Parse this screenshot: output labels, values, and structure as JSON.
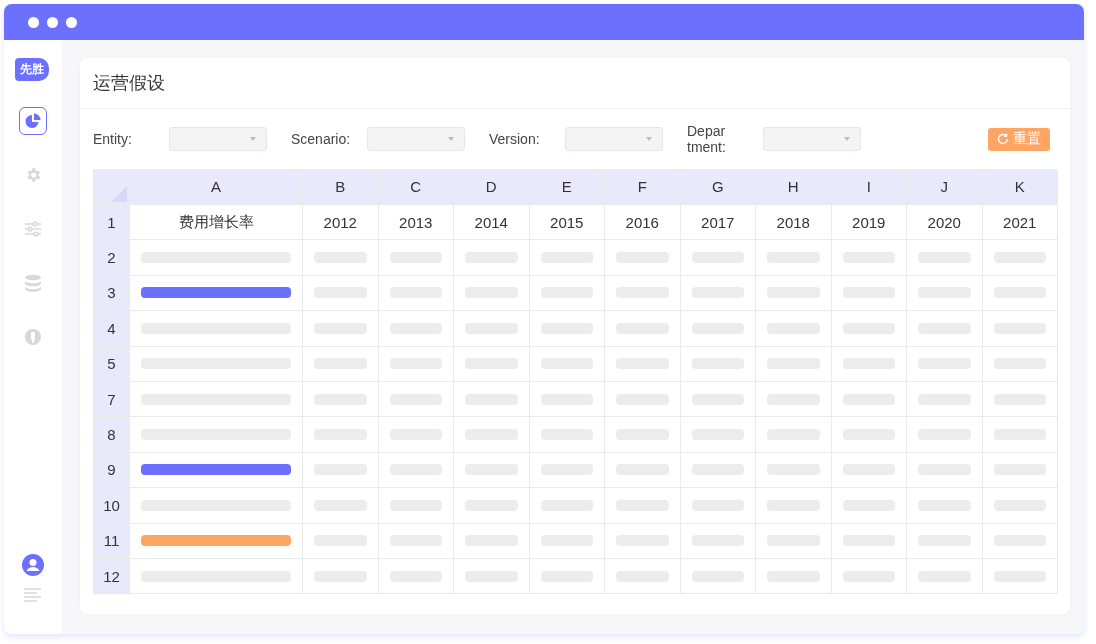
{
  "sidebar": {
    "logo": "先胜",
    "items": [
      {
        "kind": "chart",
        "selected": true
      },
      {
        "kind": "gear",
        "selected": false
      },
      {
        "kind": "sliders",
        "selected": false
      },
      {
        "kind": "database",
        "selected": false
      },
      {
        "kind": "plug",
        "selected": false
      }
    ],
    "bottom_items": [
      {
        "kind": "user"
      },
      {
        "kind": "list"
      }
    ]
  },
  "page": {
    "title": "运营假设"
  },
  "filters": [
    {
      "label": "Entity:"
    },
    {
      "label": "Scenario:"
    },
    {
      "label": "Version:"
    },
    {
      "label": "Depar tment:"
    }
  ],
  "reset_button": {
    "label": "重置"
  },
  "table": {
    "columns": [
      "A",
      "B",
      "C",
      "D",
      "E",
      "F",
      "G",
      "H",
      "I",
      "J",
      "K"
    ],
    "header_row": {
      "number": "1",
      "cells": [
        "费用增长率",
        "2012",
        "2013",
        "2014",
        "2015",
        "2016",
        "2017",
        "2018",
        "2019",
        "2020",
        "2021"
      ]
    },
    "rows": [
      {
        "number": "2"
      },
      {
        "number": "3",
        "color": "#6c70ff"
      },
      {
        "number": "4"
      },
      {
        "number": "5"
      },
      {
        "number": "7"
      },
      {
        "number": "8"
      },
      {
        "number": "9",
        "color": "#6c70ff"
      },
      {
        "number": "10"
      },
      {
        "number": "11",
        "color": "#ffa564"
      },
      {
        "number": "12"
      }
    ]
  }
}
